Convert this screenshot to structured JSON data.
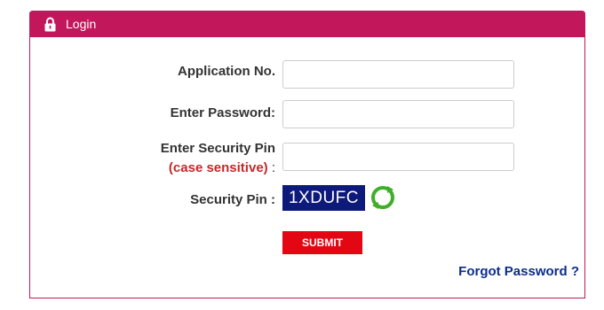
{
  "panel": {
    "title": "Login",
    "header_icon": "lock-icon",
    "accent_color": "#c2185b"
  },
  "form": {
    "application_label": "Application No.",
    "application_value": "",
    "password_label": "Enter Password:",
    "password_value": "",
    "security_pin_label": "Enter Security Pin",
    "security_pin_note": "(case sensitive)",
    "security_pin_colon": ":",
    "security_pin_value": "",
    "captcha_label": "Security Pin :",
    "captcha_text": "1XDUFC",
    "captcha_bg_color": "#0d1a7a",
    "refresh_icon": "refresh-icon",
    "submit_label": "SUBMIT",
    "submit_color": "#e30613",
    "forgot_label": "Forgot Password ?",
    "link_color": "#0d2d8a"
  }
}
